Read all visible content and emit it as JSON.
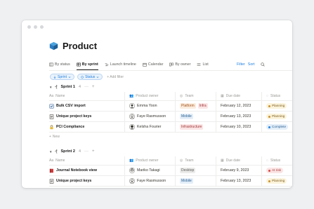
{
  "window": {
    "title": "Product"
  },
  "tabs": [
    {
      "label": "By status",
      "icon": "table-icon",
      "active": false
    },
    {
      "label": "By sprint",
      "icon": "table-icon",
      "active": true
    },
    {
      "label": "Launch timeline",
      "icon": "timeline-icon",
      "active": false
    },
    {
      "label": "Calendar",
      "icon": "calendar-icon",
      "active": false
    },
    {
      "label": "By owner",
      "icon": "board-icon",
      "active": false
    },
    {
      "label": "List",
      "icon": "list-icon",
      "active": false
    }
  ],
  "tab_actions": {
    "filter": "Filter",
    "sort": "Sort",
    "search_icon": "search-icon"
  },
  "filters": {
    "sprint": "Sprint",
    "status": "Status",
    "add_filter": "+ Add filter"
  },
  "columns": {
    "name": "Name",
    "owner": "Product owner",
    "team": "Team",
    "due": "Due date",
    "status": "Status"
  },
  "colors": {
    "accent": "#2383e2",
    "tag_platform": "#fbecdd",
    "tag_platform_text": "#a3531e",
    "tag_infra": "#fbe4e4",
    "tag_infra_text": "#a03a3a",
    "tag_mobile": "#e3eef9",
    "tag_mobile_text": "#2b5f8f",
    "tag_desktop": "#ebebea",
    "tag_desktop_text": "#5f5e5b",
    "status_planning_bg": "#fbf3db",
    "status_planning_dot": "#cb912f",
    "status_complete_bg": "#e3eef9",
    "status_complete_dot": "#2383e2",
    "status_risk_bg": "#fbe4e4",
    "status_risk_dot": "#d44c47"
  },
  "groups": [
    {
      "name": "Sprint 1",
      "count": "4",
      "rows": [
        {
          "name": "Bulk CSV import",
          "icon": "checklist-icon",
          "owner": "Emma Yoon",
          "teams": [
            "Platform",
            "Infra"
          ],
          "due": "February 12, 2023",
          "status": "Planning"
        },
        {
          "name": "Unique project keys",
          "icon": "document-icon",
          "owner": "Faye Rasmusson",
          "teams": [
            "Mobile"
          ],
          "due": "February 13, 2023",
          "status": "Planning"
        },
        {
          "name": "PCI Compliance",
          "icon": "lock-icon",
          "owner": "Kelsha Fourier",
          "teams": [
            "Infrastructure"
          ],
          "due": "February 10, 2023",
          "status": "Complete"
        }
      ],
      "new_label": "New"
    },
    {
      "name": "Sprint 2",
      "count": "4",
      "rows": [
        {
          "name": "Journal Notebook view",
          "icon": "notebook-icon",
          "owner": "Mariko Takagi",
          "teams": [
            "Desktop"
          ],
          "due": "February 9, 2023",
          "status": "At risk"
        },
        {
          "name": "Unique project keys",
          "icon": "document-icon",
          "owner": "Faye Rasmusson",
          "teams": [
            "Mobile"
          ],
          "due": "February 13, 2023",
          "status": "Planning"
        }
      ]
    }
  ]
}
